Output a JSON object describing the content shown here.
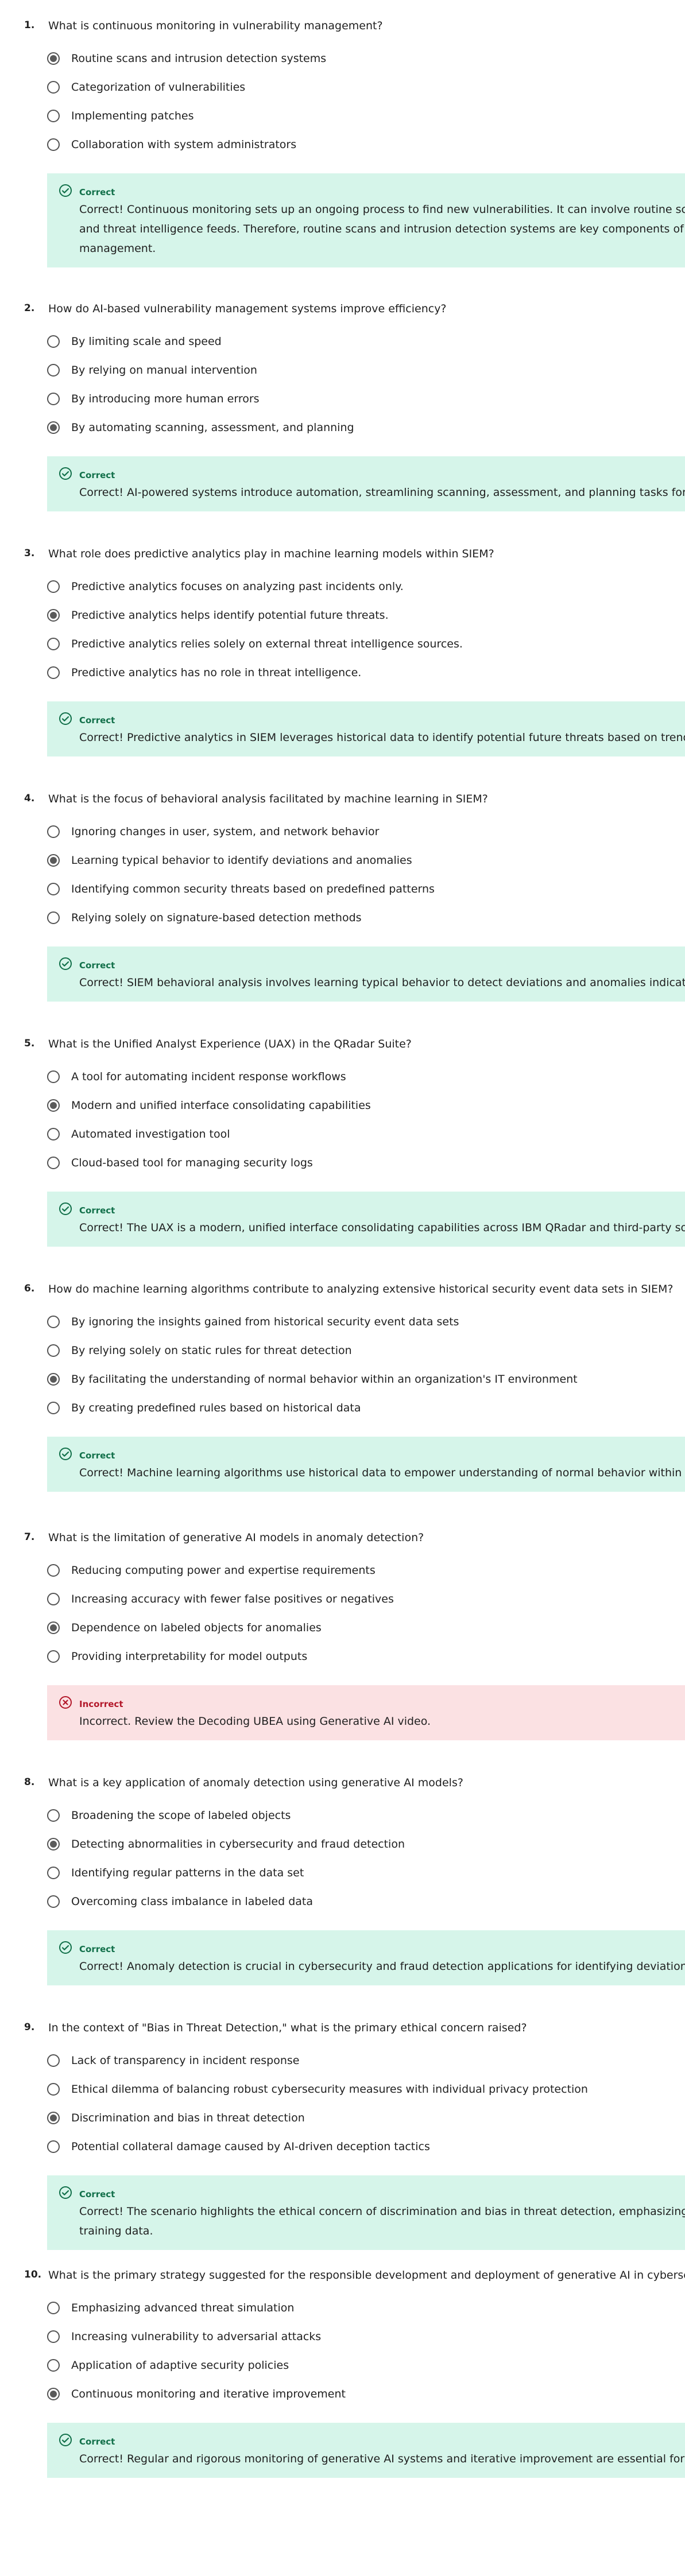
{
  "quiz": {
    "questions": [
      {
        "number": "1.",
        "text": "What is continuous monitoring in vulnerability management?",
        "options": [
          "Routine scans and intrusion detection systems",
          "Categorization of vulnerabilities",
          "Implementing patches",
          "Collaboration with system administrators"
        ],
        "selected_index": 0,
        "feedback": {
          "status": "Correct",
          "type": "correct",
          "lines": [
            "Correct! Continuous monitoring sets up an ongoing process to find new vulnerabilities. It can involve routine scans",
            "and threat intelligence feeds. Therefore, routine scans and intrusion detection systems are key components of con",
            "management."
          ]
        }
      },
      {
        "number": "2.",
        "text": "How do AI-based vulnerability management systems improve efficiency?",
        "options": [
          "By limiting scale and speed",
          "By relying on manual intervention",
          "By introducing more human errors",
          "By automating scanning, assessment, and planning"
        ],
        "selected_index": 3,
        "feedback": {
          "status": "Correct",
          "type": "correct",
          "lines": [
            "Correct! AI-powered systems introduce automation, streamlining scanning, assessment, and planning tasks for im"
          ]
        }
      },
      {
        "number": "3.",
        "text": "What role does predictive analytics play in machine learning models within SIEM?",
        "options": [
          "Predictive analytics focuses on analyzing past incidents only.",
          "Predictive analytics helps identify potential future threats.",
          "Predictive analytics relies solely on external threat intelligence sources.",
          "Predictive analytics has no role in threat intelligence."
        ],
        "selected_index": 1,
        "feedback": {
          "status": "Correct",
          "type": "correct",
          "lines": [
            "Correct! Predictive analytics in SIEM leverages historical data to identify potential future threats based on trending"
          ]
        }
      },
      {
        "number": "4.",
        "text": "What is the focus of behavioral analysis facilitated by machine learning in SIEM?",
        "options": [
          "Ignoring changes in user, system, and network behavior",
          "Learning typical behavior to identify deviations and anomalies",
          "Identifying common security threats based on predefined patterns",
          "Relying solely on signature-based detection methods"
        ],
        "selected_index": 1,
        "feedback": {
          "status": "Correct",
          "type": "correct",
          "lines": [
            "Correct! SIEM behavioral analysis involves learning typical behavior to detect deviations and anomalies indicating"
          ]
        }
      },
      {
        "number": "5.",
        "text": "What is the Unified Analyst Experience (UAX) in the QRadar Suite?",
        "options": [
          "A tool for automating incident response workflows",
          "Modern and unified interface consolidating capabilities",
          "Automated investigation tool",
          "Cloud-based tool for managing security logs"
        ],
        "selected_index": 1,
        "feedback": {
          "status": "Correct",
          "type": "correct",
          "lines": [
            "Correct! The UAX is a modern, unified interface consolidating capabilities across IBM QRadar and third-party soluti"
          ]
        }
      },
      {
        "number": "6.",
        "text": "How do machine learning algorithms contribute to analyzing extensive historical security event data sets in SIEM?",
        "options": [
          "By ignoring the insights gained from historical security event data sets",
          "By relying solely on static rules for threat detection",
          "By facilitating the understanding of normal behavior within an organization's IT environment",
          "By creating predefined rules based on historical data"
        ],
        "selected_index": 2,
        "feedback": {
          "status": "Correct",
          "type": "correct",
          "lines": [
            "Correct! Machine learning algorithms use historical data to empower understanding of normal behavior within an"
          ]
        }
      },
      {
        "number": "7.",
        "text": "What is the limitation of generative AI models in anomaly detection?",
        "options": [
          "Reducing computing power and expertise requirements",
          "Increasing accuracy with fewer false positives or negatives",
          "Dependence on labeled objects for anomalies",
          "Providing interpretability for model outputs"
        ],
        "selected_index": 2,
        "feedback": {
          "status": "Incorrect",
          "type": "incorrect",
          "lines": [
            "Incorrect. Review the Decoding UBEA using Generative AI video."
          ]
        }
      },
      {
        "number": "8.",
        "text": "What is a key application of anomaly detection using generative AI models?",
        "options": [
          "Broadening the scope of labeled objects",
          "Detecting abnormalities in cybersecurity and fraud detection",
          "Identifying regular patterns in the data set",
          "Overcoming class imbalance in labeled data"
        ],
        "selected_index": 1,
        "feedback": {
          "status": "Correct",
          "type": "correct",
          "lines": [
            "Correct! Anomaly detection is crucial in cybersecurity and fraud detection applications for identifying deviations fr"
          ]
        }
      },
      {
        "number": "9.",
        "text": "In the context of \"Bias in Threat Detection,\" what is the primary ethical concern raised?",
        "options": [
          "Lack of transparency in incident response",
          "Ethical dilemma of balancing robust cybersecurity measures with individual privacy protection",
          "Discrimination and bias in threat detection",
          "Potential collateral damage caused by AI-driven deception tactics"
        ],
        "selected_index": 2,
        "feedback": {
          "status": "Correct",
          "type": "correct",
          "lines": [
            "Correct! The scenario highlights the ethical concern of discrimination and bias in threat detection, emphasizing th",
            "training data."
          ]
        }
      },
      {
        "number": "10.",
        "text": "What is the primary strategy suggested for the responsible development and deployment of generative AI in cybersecuri",
        "options": [
          "Emphasizing advanced threat simulation",
          "Increasing vulnerability to adversarial attacks",
          "Application of adaptive security policies",
          "Continuous monitoring and iterative improvement"
        ],
        "selected_index": 3,
        "feedback": {
          "status": "Correct",
          "type": "correct",
          "lines": [
            "Correct! Regular and rigorous monitoring of generative AI systems and iterative improvement are essential for ach"
          ]
        }
      }
    ]
  },
  "colors": {
    "correct_bg": "#d6f5ea",
    "correct_accent": "#12704a",
    "incorrect_bg": "#fbe1e3",
    "incorrect_accent": "#b3182a"
  },
  "icons": {
    "correct": "check-circle-icon",
    "incorrect": "x-circle-icon"
  }
}
